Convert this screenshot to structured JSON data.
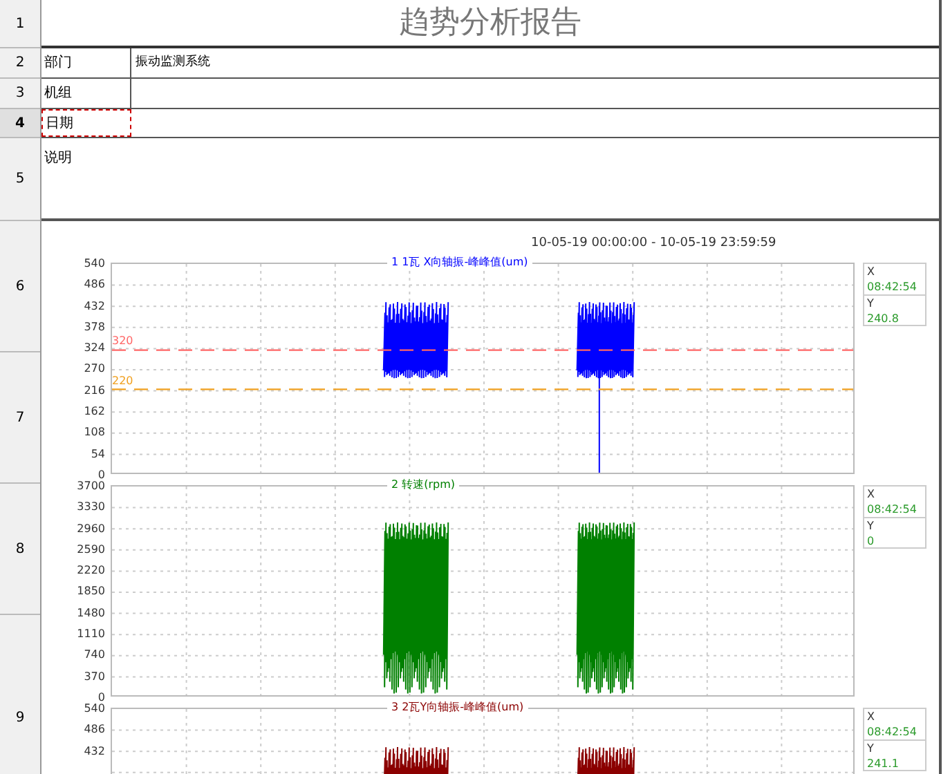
{
  "row_headers": [
    {
      "label": "1",
      "selected": false
    },
    {
      "label": "2",
      "selected": false
    },
    {
      "label": "3",
      "selected": false
    },
    {
      "label": "4",
      "selected": true
    },
    {
      "label": "5",
      "selected": false
    },
    {
      "label": "6",
      "selected": false
    },
    {
      "label": "7",
      "selected": false
    },
    {
      "label": "8",
      "selected": false
    },
    {
      "label": "9",
      "selected": false
    }
  ],
  "report_title": "趋势分析报告",
  "fields": [
    {
      "label": "部门",
      "value": "振动监测系统",
      "selected": false
    },
    {
      "label": "机组",
      "selected": false
    },
    {
      "label": "日期",
      "selected": true
    }
  ],
  "notes_label": "说明",
  "date_range": "10-05-19 00:00:00 - 10-05-19 23:59:59",
  "charts": [
    {
      "kind": "vibration",
      "title": "1   1瓦 X向轴振-峰峰值(um)",
      "color": "#0000ff",
      "yticks": [
        "540",
        "486",
        "432",
        "378",
        "324",
        "270",
        "216",
        "162",
        "108",
        "54",
        "0"
      ],
      "thresholds": [
        {
          "label": "320",
          "color": "#ff6666"
        },
        {
          "label": "220",
          "color": "#f0a020"
        }
      ],
      "legend": {
        "x_label": "X",
        "x_value": "08:42:54",
        "y_label": "Y",
        "y_value": "240.8"
      }
    },
    {
      "kind": "speed",
      "title": "2   转速(rpm)",
      "color": "#008000",
      "yticks": [
        "3700",
        "3330",
        "2960",
        "2590",
        "2220",
        "1850",
        "1480",
        "1110",
        "740",
        "370",
        "0"
      ],
      "legend": {
        "x_label": "X",
        "x_value": "08:42:54",
        "y_label": "Y",
        "y_value": "0"
      }
    },
    {
      "kind": "vibration",
      "title": "3   2瓦Y向轴振-峰峰值(um)",
      "color": "#8b0000",
      "yticks": [
        "540",
        "486",
        "432"
      ],
      "legend": {
        "x_label": "X",
        "x_value": "08:42:54",
        "y_label": "Y",
        "y_value": "241.1"
      }
    }
  ]
}
